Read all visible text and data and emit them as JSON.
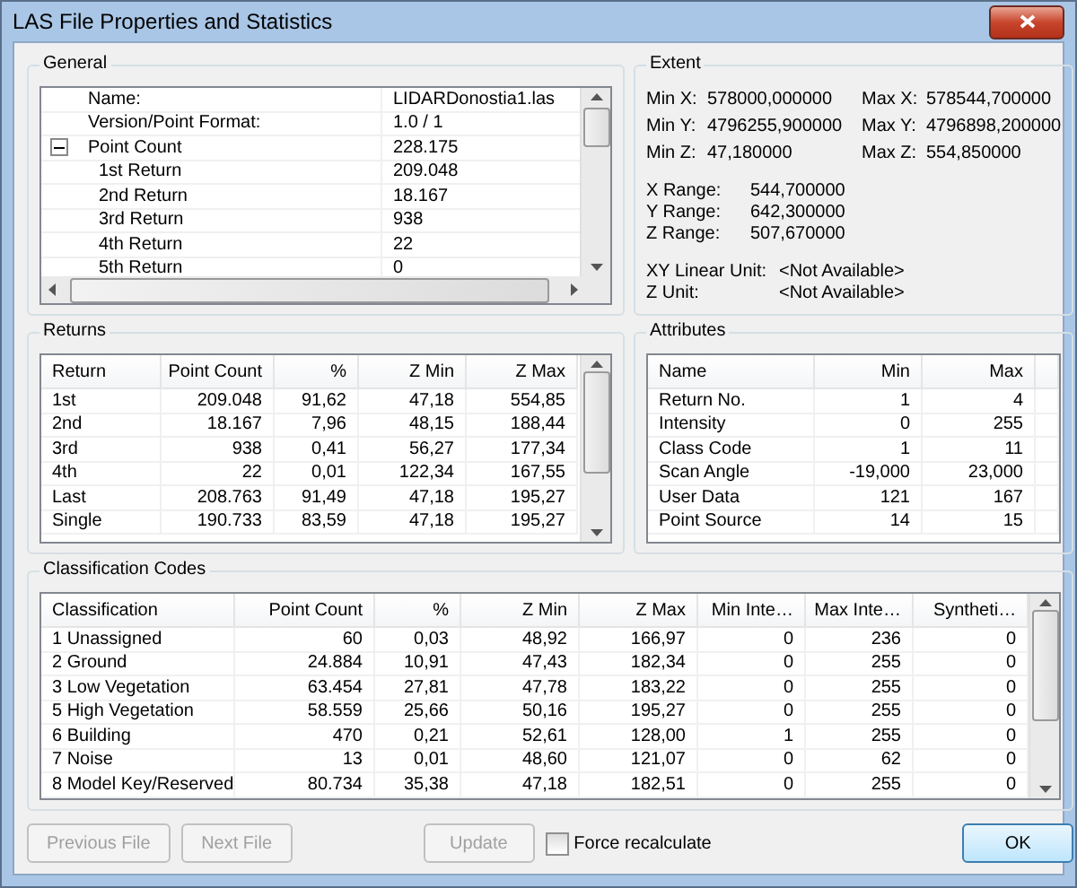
{
  "window": {
    "title": "LAS File Properties and Statistics"
  },
  "general": {
    "title": "General",
    "properties": [
      {
        "label": "Name:",
        "value": "LIDARDonostia1.las"
      },
      {
        "label": "Version/Point Format:",
        "value": "1.0 / 1"
      },
      {
        "label": "Point Count",
        "value": "228.175",
        "expanded": true,
        "children": [
          {
            "label": "1st Return",
            "value": "209.048"
          },
          {
            "label": "2nd Return",
            "value": "18.167"
          },
          {
            "label": "3rd Return",
            "value": "938"
          },
          {
            "label": "4th Return",
            "value": "22"
          },
          {
            "label": "5th Return",
            "value": "0"
          }
        ]
      }
    ]
  },
  "extent": {
    "title": "Extent",
    "pairs": [
      {
        "label": "Min X:",
        "value": "578000,000000",
        "label2": "Max X:",
        "value2": "578544,700000"
      },
      {
        "label": "Min Y:",
        "value": "4796255,900000",
        "label2": "Max Y:",
        "value2": "4796898,200000"
      },
      {
        "label": "Min Z:",
        "value": "47,180000",
        "label2": "Max Z:",
        "value2": "554,850000"
      }
    ],
    "ranges": [
      {
        "label": "X Range:",
        "value": "544,700000"
      },
      {
        "label": "Y Range:",
        "value": "642,300000"
      },
      {
        "label": "Z Range:",
        "value": "507,670000"
      }
    ],
    "units": [
      {
        "label": "XY Linear Unit:",
        "value": "<Not Available>"
      },
      {
        "label": "Z Unit:",
        "value": "<Not Available>"
      }
    ]
  },
  "returns": {
    "title": "Returns",
    "columns": [
      "Return",
      "Point Count",
      "%",
      "Z Min",
      "Z Max"
    ],
    "rows": [
      [
        "1st",
        "209.048",
        "91,62",
        "47,18",
        "554,85"
      ],
      [
        "2nd",
        "18.167",
        "7,96",
        "48,15",
        "188,44"
      ],
      [
        "3rd",
        "938",
        "0,41",
        "56,27",
        "177,34"
      ],
      [
        "4th",
        "22",
        "0,01",
        "122,34",
        "167,55"
      ],
      [
        "Last",
        "208.763",
        "91,49",
        "47,18",
        "195,27"
      ],
      [
        "Single",
        "190.733",
        "83,59",
        "47,18",
        "195,27"
      ]
    ]
  },
  "attributes": {
    "title": "Attributes",
    "columns": [
      "Name",
      "Min",
      "Max"
    ],
    "rows": [
      [
        "Return No.",
        "1",
        "4"
      ],
      [
        "Intensity",
        "0",
        "255"
      ],
      [
        "Class Code",
        "1",
        "11"
      ],
      [
        "Scan Angle",
        "-19,000",
        "23,000"
      ],
      [
        "User Data",
        "121",
        "167"
      ],
      [
        "Point Source",
        "14",
        "15"
      ]
    ]
  },
  "classification": {
    "title": "Classification Codes",
    "columns": [
      "Classification",
      "Point Count",
      "%",
      "Z Min",
      "Z Max",
      "Min Inte…",
      "Max Inte…",
      "Syntheti…"
    ],
    "rows": [
      [
        "1  Unassigned",
        "60",
        "0,03",
        "48,92",
        "166,97",
        "0",
        "236",
        "0"
      ],
      [
        "2  Ground",
        "24.884",
        "10,91",
        "47,43",
        "182,34",
        "0",
        "255",
        "0"
      ],
      [
        "3  Low Vegetation",
        "63.454",
        "27,81",
        "47,78",
        "183,22",
        "0",
        "255",
        "0"
      ],
      [
        "5  High Vegetation",
        "58.559",
        "25,66",
        "50,16",
        "195,27",
        "0",
        "255",
        "0"
      ],
      [
        "6  Building",
        "470",
        "0,21",
        "52,61",
        "128,00",
        "1",
        "255",
        "0"
      ],
      [
        "7  Noise",
        "13",
        "0,01",
        "48,60",
        "121,07",
        "0",
        "62",
        "0"
      ],
      [
        "8  Model Key/Reserved",
        "80.734",
        "35,38",
        "47,18",
        "182,51",
        "0",
        "255",
        "0"
      ]
    ]
  },
  "footer": {
    "buttons": [
      {
        "label": "Previous File",
        "disabled": true
      },
      {
        "label": "Next File",
        "disabled": true
      },
      {
        "label": "Update",
        "disabled": true
      }
    ],
    "force": {
      "label": "Force recalculate",
      "checked": false
    },
    "ok": {
      "label": "OK",
      "disabled": false
    }
  }
}
